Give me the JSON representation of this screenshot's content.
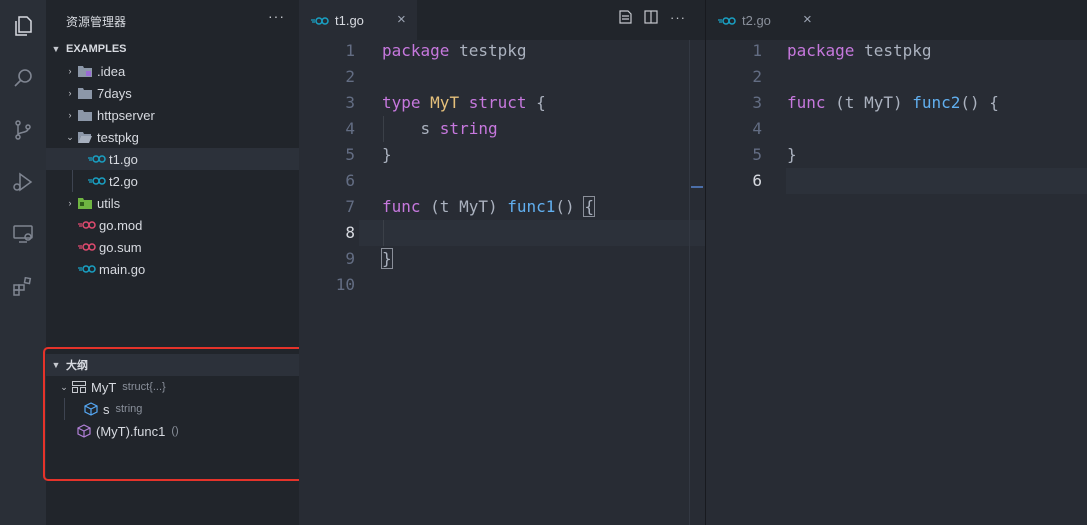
{
  "sidebar": {
    "title": "资源管理器",
    "more": "···",
    "explorer_section": "EXAMPLES",
    "tree": [
      {
        "label": ".idea",
        "kind": "folder",
        "color": "#9a6bd4"
      },
      {
        "label": "7days",
        "kind": "folder",
        "color": "#8c97a8"
      },
      {
        "label": "httpserver",
        "kind": "folder",
        "color": "#8c97a8"
      },
      {
        "label": "testpkg",
        "kind": "folder-open",
        "color": "#8c97a8"
      },
      {
        "label": "t1.go",
        "kind": "go-file",
        "color": "#19a1c4"
      },
      {
        "label": "t2.go",
        "kind": "go-file",
        "color": "#19a1c4"
      },
      {
        "label": "utils",
        "kind": "folder",
        "color": "#6fb542"
      },
      {
        "label": "go.mod",
        "kind": "go-mod",
        "color": "#e04b6f"
      },
      {
        "label": "go.sum",
        "kind": "go-mod",
        "color": "#e04b6f"
      },
      {
        "label": "main.go",
        "kind": "go-file",
        "color": "#19a1c4"
      }
    ],
    "outline_section": "大纲",
    "outline": [
      {
        "name": "MyT",
        "detail": "struct{...}",
        "icon": "struct-icon"
      },
      {
        "name": "s",
        "detail": "string",
        "icon": "field-icon"
      },
      {
        "name": "(MyT).func1",
        "detail": "()",
        "icon": "method-icon"
      }
    ]
  },
  "editor_left": {
    "tab": "t1.go",
    "close": "×",
    "line_numbers": [
      "1",
      "2",
      "3",
      "4",
      "5",
      "6",
      "7",
      "8",
      "9",
      "10"
    ],
    "tokens": {
      "l1a": "package",
      "l1b": " testpkg",
      "l3a": "type",
      "l3b": "MyT",
      "l3c": "struct",
      "l3d": " {",
      "l4a": "    s ",
      "l4b": "string",
      "l5": "}",
      "l7a": "func",
      "l7b": " (t MyT) ",
      "l7c": "func1",
      "l7d": "() ",
      "l7e": "{",
      "l9": "}"
    }
  },
  "editor_right": {
    "tab": "t2.go",
    "close": "×",
    "line_numbers": [
      "1",
      "2",
      "3",
      "4",
      "5",
      "6"
    ],
    "tokens": {
      "l1a": "package",
      "l1b": " testpkg",
      "l3a": "func",
      "l3b": " (t MyT) ",
      "l3c": "func2",
      "l3d": "() {",
      "l5": "}"
    }
  },
  "colors": {
    "keyword": "#c678dd",
    "type": "#e5c07b",
    "function": "#61afef",
    "highlight_box": "#e5332a"
  }
}
